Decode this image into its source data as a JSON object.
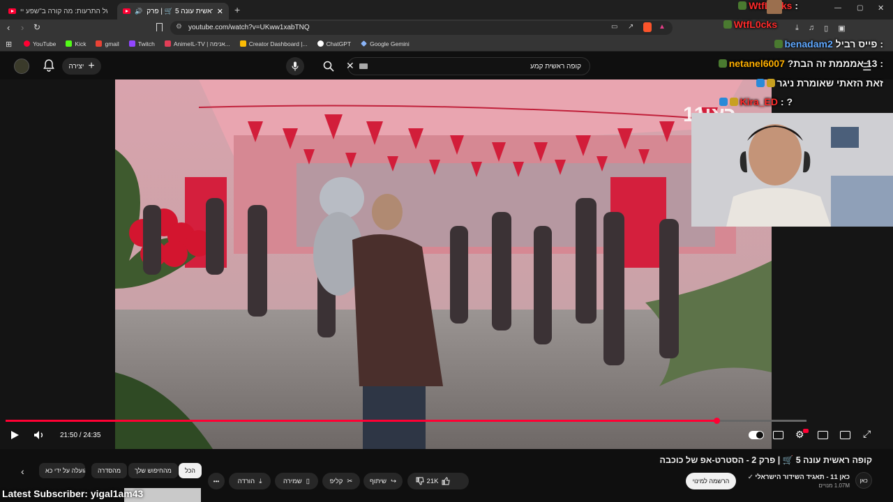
{
  "browser": {
    "tabs": [
      {
        "title": "שפע של התרעות: מה קורה ב\"שפע יי"
      },
      {
        "title": "קופה ראשית עונה 5 🛒 | פרק"
      }
    ],
    "url": "youtube.com/watch?v=UKww1xabTNQ",
    "bookmarks": [
      {
        "label": "YouTube",
        "color": "#ff0033"
      },
      {
        "label": "Kick",
        "color": "#53fc18"
      },
      {
        "label": "gmail",
        "color": "#ea4335"
      },
      {
        "label": "Twitch",
        "color": "#9146ff"
      },
      {
        "label": "AnimeIL-TV | אנימה...",
        "color": "#e23e57"
      },
      {
        "label": "Creator Dashboard |...",
        "color": "#fbbc05"
      },
      {
        "label": "ChatGPT",
        "color": "#ffffff"
      },
      {
        "label": "Google Gemini",
        "color": "#8ab4f8"
      }
    ]
  },
  "youtube": {
    "create_label": "יצירה",
    "search_query": "קופה ראשית קמע",
    "logo_text": "YouTube"
  },
  "player": {
    "time": "21:50 / 24:35",
    "progress": 0.888,
    "watermark": "כאן11"
  },
  "video_info": {
    "title": "קופה ראשית עונה 5 🛒 | פרק 2 - הסטרט-אפ של כוכבה",
    "channel": "כאן 11 - תאגיד השידור הישראלי",
    "subscribers": "1.07M מנויים",
    "subscribe_label": "הרשמה למינוי",
    "likes": "21K",
    "share_label": "שיתוף",
    "clip_label": "קליפ",
    "save_label": "שמירה",
    "download_label": "הורדה",
    "more_label": "•••",
    "channel_avatar_text": "כאן"
  },
  "chips": [
    {
      "label": "הכל",
      "active": true
    },
    {
      "label": "מהחיפוש שלך"
    },
    {
      "label": "מהסדרה"
    },
    {
      "label": "הועלה על ידי כא"
    }
  ],
  "stream_overlay": {
    "chat": [
      {
        "user": "WtfL0cks",
        "message": ":",
        "color": "#ff2a2a"
      },
      {
        "user": "WtfL0cks",
        "message": "",
        "color": "#ff2a2a"
      },
      {
        "user": "benadam2",
        "message": ": פייס רביל",
        "color": "#5fa8ff"
      },
      {
        "user": "netanel6007",
        "message": ": 13 אמממת זה הבת?",
        "color": "#ffb000"
      },
      {
        "user": "",
        "message": "זאת הזאתי שאומרת ניגר",
        "color": "#ffffff"
      },
      {
        "user": "Kira_ED",
        "message": ": ?",
        "color": "#ff2a2a"
      }
    ],
    "latest_subscriber": "Latest Subscriber: yigal1am43"
  }
}
